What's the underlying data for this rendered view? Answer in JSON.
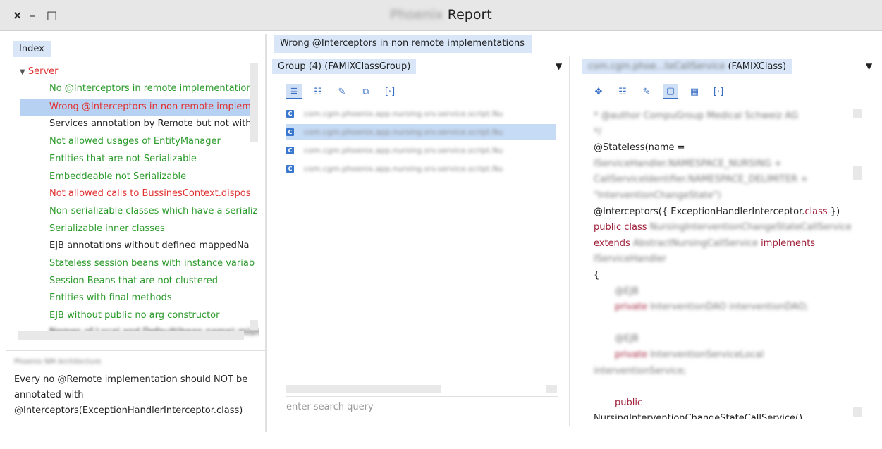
{
  "window": {
    "title_blurred": "Phoenix",
    "title": "Report",
    "controls": [
      "×",
      "–",
      "□"
    ]
  },
  "left": {
    "tab": "Index",
    "tree_root": "Server",
    "items": [
      {
        "label": "No @Interceptors in remote implementation",
        "color": "green"
      },
      {
        "label": "Wrong @Interceptors in non remote implem",
        "color": "red",
        "selected": true
      },
      {
        "label": "Services annotation by Remote but not with",
        "color": "black"
      },
      {
        "label": "Not allowed usages of EntityManager",
        "color": "green"
      },
      {
        "label": "Entities that are not Serializable",
        "color": "green"
      },
      {
        "label": "Embeddeable not Serializable",
        "color": "green"
      },
      {
        "label": "Not allowed calls to BussinesContext.dispos",
        "color": "red"
      },
      {
        "label": "Non-serializable classes which have a serializ",
        "color": "green"
      },
      {
        "label": "Serializable inner classes",
        "color": "green"
      },
      {
        "label": "EJB annotations without defined mappedNa",
        "color": "black"
      },
      {
        "label": "Stateless session beans with instance variab",
        "color": "green"
      },
      {
        "label": "Session Beans that are not clustered",
        "color": "green"
      },
      {
        "label": "Entities with final methods",
        "color": "green"
      },
      {
        "label": "EJB without public no arg constructor",
        "color": "green"
      }
    ],
    "desc_header": "Phoenix NM Architecture",
    "description": "Every no @Remote implementation should NOT be annotated with @Interceptors(ExceptionHandlerInterceptor.class)"
  },
  "middle": {
    "tab": "Wrong @Interceptors in non remote implementations",
    "group": "Group (4) (FAMIXClassGroup)",
    "rows": [
      "com.cgm.phoenix.app.nursing.srv.service.script.Nu",
      "com.cgm.phoenix.app.nursing.srv.service.script.Nu",
      "com.cgm.phoenix.app.nursing.srv.service.script.Nu",
      "com.cgm.phoenix.app.nursing.srv.service.script.Nu"
    ],
    "search_placeholder": "enter search query"
  },
  "right": {
    "class_blurred": "com.cgm.phoe...teCallService",
    "class_type": "(FAMIXClass)",
    "code": {
      "comment1": "* @author CompuGroup Medical Schweiz AG",
      "comment2": "*/",
      "stateless": "@Stateless(name =",
      "name1": "IServiceHandler.NAMESPACE_NURSING +",
      "name2": "CallServiceIdentifier.NAMESPACE_DELIMITER +",
      "name3": "\"InterventionChangeState\")",
      "interceptors_pre": "@Interceptors({ ExceptionHandlerInterceptor.",
      "interceptors_kw": "class",
      "interceptors_post": " })",
      "public_class": "public class",
      "class_name": " NursingInterventionChangeStateCallService",
      "extends": "extends",
      "super_name": " AbstractNursingCallService ",
      "implements": "implements",
      "iface": "IServiceHandler",
      "brace": "{",
      "ejb1": "@EJB",
      "private1": "private",
      "field1": " InterventionDAO interventionDAO;",
      "ejb2": "@EJB",
      "private2": "private",
      "field2": " InterventionServiceLocal",
      "field2b": "interventionService;",
      "public": "public",
      "ctor": "NursingInterventionChangeStateCallService()"
    }
  }
}
